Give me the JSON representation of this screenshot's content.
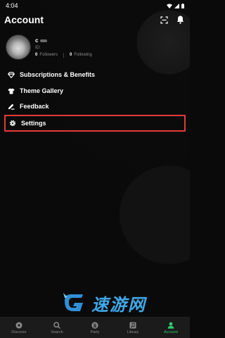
{
  "status_bar": {
    "time": "4:04"
  },
  "header": {
    "title": "Account"
  },
  "profile": {
    "name": "c",
    "id_label": "ID:",
    "followers_count": "0",
    "followers_label": "Followers",
    "following_count": "0",
    "following_label": "Following"
  },
  "menu": {
    "items": [
      {
        "label": "Subscriptions & Benefits",
        "icon": "diamond-icon"
      },
      {
        "label": "Theme Gallery",
        "icon": "shirt-icon"
      },
      {
        "label": "Feedback",
        "icon": "pencil-icon"
      },
      {
        "label": "Settings",
        "icon": "gear-icon"
      }
    ],
    "highlighted_item": "Settings",
    "highlight_color": "#e33a3a"
  },
  "watermark": {
    "text": "速游网"
  },
  "bottom_nav": {
    "items": [
      {
        "label": "Discover",
        "icon": "discover-icon"
      },
      {
        "label": "Search",
        "icon": "search-icon"
      },
      {
        "label": "Party",
        "icon": "party-icon"
      },
      {
        "label": "Library",
        "icon": "library-icon"
      },
      {
        "label": "Account",
        "icon": "account-icon"
      }
    ],
    "active": "Account",
    "active_color": "#2ecc71"
  }
}
